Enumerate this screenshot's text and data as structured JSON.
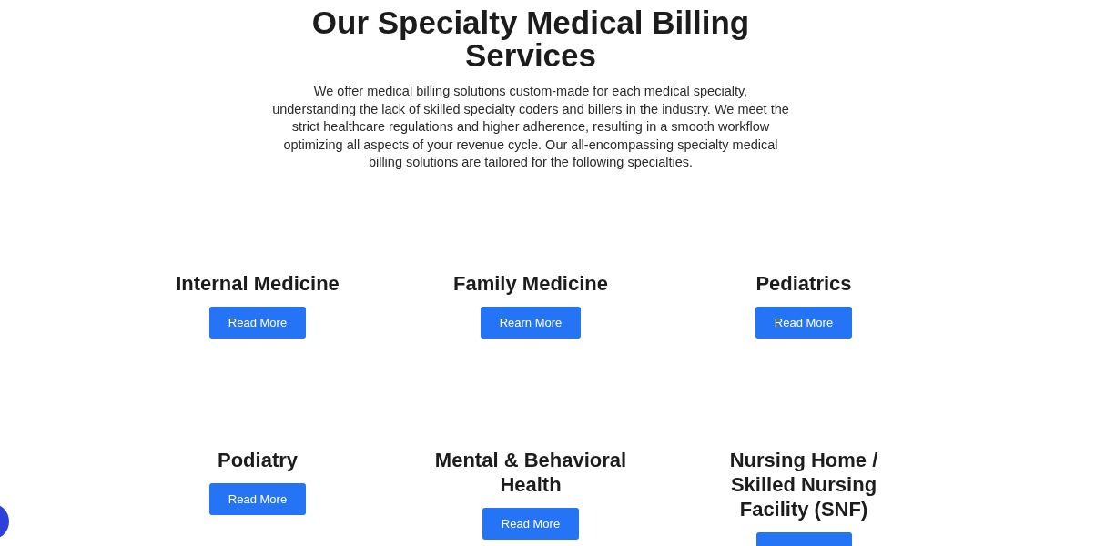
{
  "heading": "Our Specialty Medical Billing Services",
  "intro": "We offer medical billing solutions custom-made for each medical specialty, understanding the lack of skilled specialty coders and billers in the industry. We meet the strict healthcare regulations and higher adherence, resulting in a smooth workflow optimizing all aspects of your revenue cycle. Our all-encompassing specialty medical billing solutions are tailored for the following specialties.",
  "specialties": [
    {
      "title": "Internal Medicine",
      "button": {
        "kind": "full",
        "label": "Read More"
      }
    },
    {
      "title": "Family Medicine",
      "button": {
        "kind": "full",
        "label": "Rearn More"
      }
    },
    {
      "title": "Pediatrics",
      "button": {
        "kind": "full",
        "label": "Read More"
      }
    },
    {
      "title": "Podiatry",
      "button": {
        "kind": "full",
        "label": "Read More"
      }
    },
    {
      "title": "Mental & Behavioral Health",
      "button": {
        "kind": "full",
        "label": "Read More"
      }
    },
    {
      "title": "Nursing Home / Skilled Nursing Facility (SNF)",
      "button": {
        "kind": "clipped"
      }
    }
  ]
}
